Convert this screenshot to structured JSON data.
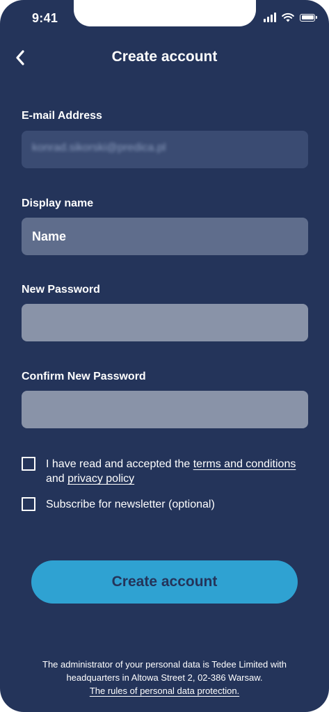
{
  "status_bar": {
    "time": "9:41",
    "icons": [
      "signal-icon",
      "wifi-icon",
      "battery-icon"
    ]
  },
  "header": {
    "back_icon": "chevron-left-icon",
    "title": "Create account"
  },
  "form": {
    "email": {
      "label": "E-mail Address",
      "value": "konrad.sikorski@predica.pl"
    },
    "display_name": {
      "label": "Display name",
      "placeholder": "Name"
    },
    "new_password": {
      "label": "New Password"
    },
    "confirm_password": {
      "label": "Confirm New Password"
    }
  },
  "checkboxes": {
    "terms": {
      "text_before": "I have read and accepted the ",
      "terms_link": "terms and conditions",
      "text_middle": "and ",
      "privacy_link": "privacy policy",
      "checked": false
    },
    "newsletter": {
      "text": "Subscribe for newsletter (optional)",
      "checked": false
    }
  },
  "primary_button": {
    "label": "Create account"
  },
  "footer": {
    "line1": "The administrator of your personal data is Tedee Limited with headquarters in Altowa Street 2, 02-386 Warsaw.",
    "link": "The rules of personal data protection."
  },
  "colors": {
    "background": "#24345a",
    "email_field": "#3a4b72",
    "name_field": "#5f6d8c",
    "password_field": "#8993a8",
    "button": "#2fa2d2",
    "text": "#ffffff"
  }
}
